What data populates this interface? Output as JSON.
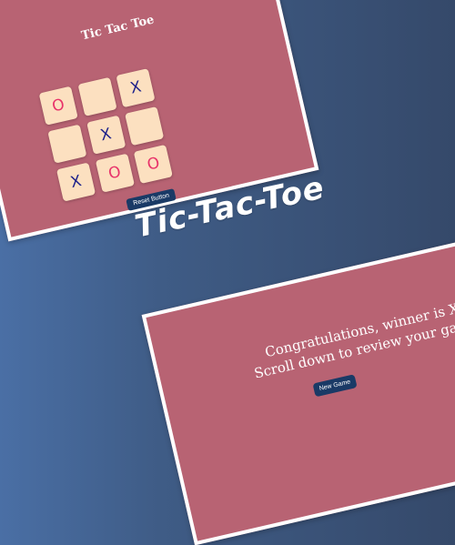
{
  "page_title": "Tic-Tac-Toe",
  "top_panel": {
    "title": "Tic Tac Toe",
    "board": [
      "O",
      "",
      "X",
      "",
      "X",
      "",
      "X",
      "O",
      "O"
    ],
    "reset_label": "Reset Button"
  },
  "bottom_panel": {
    "message_line1": "Congratulations, winner is X",
    "message_line2": "Scroll down to review your game",
    "new_game_label": "New Game"
  },
  "colors": {
    "panel": "#b86373",
    "cell": "#fce0c0",
    "x_mark": "#1b1f8a",
    "o_mark": "#e8336a",
    "button": "#1a3a66"
  }
}
